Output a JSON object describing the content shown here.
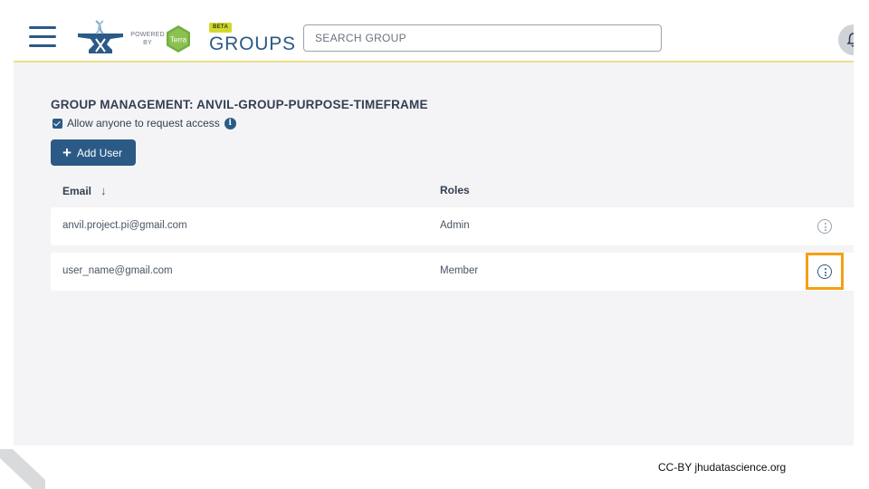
{
  "header": {
    "menu_icon": "hamburger-menu-icon",
    "powered_by_line1": "POWERED",
    "powered_by_line2": "BY",
    "terra_label": "Terra",
    "beta_label": "BETA",
    "app_title": "GROUPS",
    "search_placeholder": "SEARCH GROUP",
    "search_value": "",
    "notification_icon": "bell-icon"
  },
  "main": {
    "page_title": "GROUP MANAGEMENT: ANVIL-GROUP-PURPOSE-TIMEFRAME",
    "allow_access_label": "Allow anyone to request access",
    "allow_access_checked": true,
    "info_symbol": "i",
    "add_user_plus": "+",
    "add_user_label": "Add User",
    "columns": {
      "email": "Email",
      "email_sort_symbol": "↓",
      "roles": "Roles"
    },
    "rows": [
      {
        "email": "anvil.project.pi@gmail.com",
        "role": "Admin"
      },
      {
        "email": "user_name@gmail.com",
        "role": "Member"
      }
    ]
  },
  "footer": {
    "credit": "CC-BY jhudatascience.org"
  },
  "colors": {
    "primary": "#2b5a86",
    "highlight": "#f5a015",
    "beta_badge": "#d1d92b",
    "terra_green": "#74ae43",
    "page_background": "#f4f4f6"
  }
}
